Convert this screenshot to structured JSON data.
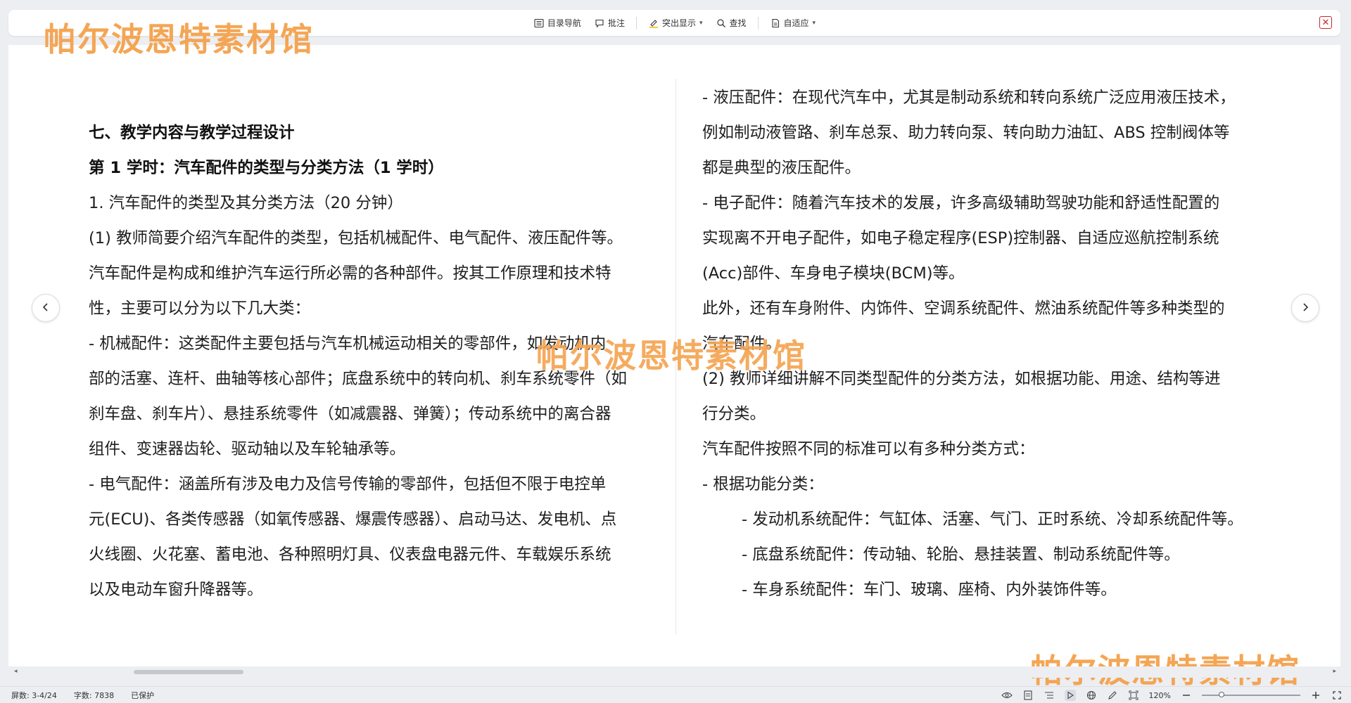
{
  "toolbar": {
    "toc_label": "目录导航",
    "comment_label": "批注",
    "highlight_label": "突出显示",
    "find_label": "查找",
    "fit_label": "自适应"
  },
  "watermark": {
    "text": "帕尔波恩特素材馆"
  },
  "document": {
    "left": {
      "heading": "七、教学内容与教学过程设计",
      "subheading": "第 1 学时：汽车配件的类型与分类方法（1 学时）",
      "lines": [
        "1. 汽车配件的类型及其分类方法（20 分钟）",
        "(1) 教师简要介绍汽车配件的类型，包括机械配件、电气配件、液压配件等。",
        "汽车配件是构成和维护汽车运行所必需的各种部件。按其工作原理和技术特",
        "性，主要可以分为以下几大类：",
        "- 机械配件：这类配件主要包括与汽车机械运动相关的零部件，如发动机内",
        "部的活塞、连杆、曲轴等核心部件；底盘系统中的转向机、刹车系统零件（如",
        "刹车盘、刹车片）、悬挂系统零件（如减震器、弹簧）；传动系统中的离合器",
        "组件、变速器齿轮、驱动轴以及车轮轴承等。",
        "- 电气配件：涵盖所有涉及电力及信号传输的零部件，包括但不限于电控单",
        "元(ECU)、各类传感器（如氧传感器、爆震传感器）、启动马达、发电机、点",
        "火线圈、火花塞、蓄电池、各种照明灯具、仪表盘电器元件、车载娱乐系统",
        "以及电动车窗升降器等。"
      ]
    },
    "right": {
      "lines": [
        "- 液压配件：在现代汽车中，尤其是制动系统和转向系统广泛应用液压技术，",
        "例如制动液管路、刹车总泵、助力转向泵、转向助力油缸、ABS 控制阀体等",
        "都是典型的液压配件。",
        "- 电子配件：随着汽车技术的发展，许多高级辅助驾驶功能和舒适性配置的",
        "实现离不开电子配件，如电子稳定程序(ESP)控制器、自适应巡航控制系统",
        "(Acc)部件、车身电子模块(BCM)等。",
        "此外，还有车身附件、内饰件、空调系统配件、燃油系统配件等多种类型的",
        "汽车配件。",
        "(2) 教师详细讲解不同类型配件的分类方法，如根据功能、用途、结构等进",
        "行分类。",
        "汽车配件按照不同的标准可以有多种分类方式：",
        "- 根据功能分类："
      ],
      "indented_lines": [
        "- 发动机系统配件：气缸体、活塞、气门、正时系统、冷却系统配件等。",
        "- 底盘系统配件：传动轴、轮胎、悬挂装置、制动系统配件等。",
        "- 车身系统配件：车门、玻璃、座椅、内外装饰件等。"
      ]
    }
  },
  "status": {
    "page": "屏数: 3-4/24",
    "word_count": "字数: 7838",
    "protected": "已保护",
    "zoom": "120%",
    "zoom_fraction": 0.2
  },
  "colors": {
    "watermark": "#f29637",
    "close": "#c62828"
  }
}
